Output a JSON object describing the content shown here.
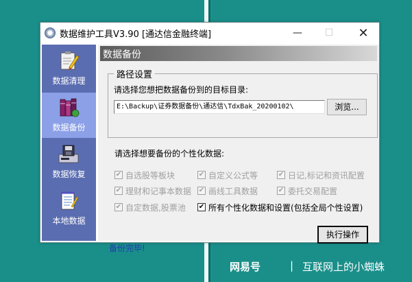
{
  "window": {
    "title": "数据维护工具V3.90 [通达信金融终端]",
    "min_glyph": "—",
    "max_glyph": "☐",
    "close_glyph": "✕"
  },
  "sidebar": {
    "items": [
      {
        "label": "数据清理",
        "icon": "clipboard-pencil-icon",
        "active": false
      },
      {
        "label": "数据备份",
        "icon": "books-icon",
        "active": true
      },
      {
        "label": "数据恢复",
        "icon": "floppy-disk-icon",
        "active": false
      },
      {
        "label": "本地数据",
        "icon": "notepad-icon",
        "active": false
      }
    ],
    "bg_color": "#5b6db1",
    "active_color": "#8ba0e6"
  },
  "panel": {
    "header": "数据备份",
    "path_group": {
      "legend": "路径设置",
      "hint": "请选择您想把数据备份到的目标目录:",
      "path_value": "E:\\Backup\\证券数据备份\\通达信\\TdxBak_20200102\\",
      "browse_label": "浏览..."
    },
    "options_hint": "请选择想要备份的个性化数据:",
    "options": [
      {
        "label": "自选股等板块",
        "checked": true,
        "enabled": false
      },
      {
        "label": "自定义公式等",
        "checked": true,
        "enabled": false
      },
      {
        "label": "日记,标记和资讯配置",
        "checked": true,
        "enabled": false
      },
      {
        "label": "理财和记事本数据",
        "checked": true,
        "enabled": false
      },
      {
        "label": "画线工具数据",
        "checked": true,
        "enabled": false
      },
      {
        "label": "委托交易配置",
        "checked": true,
        "enabled": false
      },
      {
        "label": "自定数据,股票池",
        "checked": true,
        "enabled": false
      },
      {
        "label": "所有个性化数据和设置(包括全局个性设置)",
        "checked": true,
        "enabled": true
      }
    ],
    "execute_label": "执行操作",
    "status": "备份完毕!"
  },
  "watermark": {
    "logo": "网易号",
    "separator": "|",
    "text": "互联网上的小蜘蛛"
  },
  "colors": {
    "desktop": "#1a8f8a",
    "status_text": "#1f3fa8"
  }
}
